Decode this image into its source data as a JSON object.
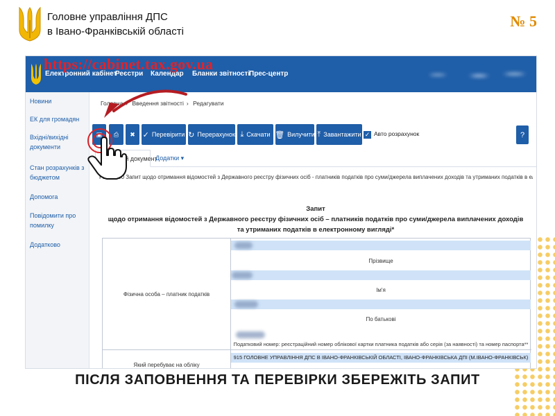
{
  "header": {
    "org_line1": "Головне управління ДПС",
    "org_line2": "в Івано-Франківській області",
    "slide_number": "№ 5"
  },
  "cabinet": {
    "url": "https://cabinet.tax.gov.ua",
    "nav": [
      "Електронний кабінет",
      "Реєстри",
      "Календар",
      "Бланки звітності",
      "Прес-центр"
    ],
    "sidebar": [
      "Новини",
      "ЕК для громадян",
      "Вхідні/вихідні документи",
      "Стан розрахунків з бюджетом",
      "Допомога",
      "Повідомити про помилку",
      "Додатково"
    ],
    "breadcrumbs": [
      "Головна",
      "Введення звітності",
      "Редагувати"
    ],
    "toolbar": {
      "verify": "Перевірити",
      "recalc": "Перерахунок",
      "download": "Скачати",
      "delete": "Вилучити",
      "upload": "Завантажити",
      "auto_calc": "Авто розрахунок",
      "help": "?"
    },
    "tabs": {
      "main": "Головний документ",
      "extra": "Додатки ▾"
    },
    "description": "F1300000 Запит щодо отримання відомостей з Державного реєстру фізичних осіб - платників податків про суми/джерела виплачених доходів та утриманих податків в електронному вигляді",
    "document": {
      "title": "Запит",
      "subtitle": "щодо отримання відомостей з Державного реєстру фізичних осіб – платників податків про суми/джерела виплачених доходів та утриманих податків в електронному вигляді*",
      "person_label": "Фізична особа – платник податків",
      "surname": "Прізвище",
      "name": "Ім'я",
      "patronymic": "По батькові",
      "tax_number_note": "Податковий номер: реєстраційний номер облікової картки платника податків або серія (за наявності) та номер паспорта**",
      "registered_label": "Який перебуває на обліку",
      "tax_office": "915 ГОЛОВНЕ УПРАВЛІННЯ ДПС В ІВАНО-ФРАНКІВСЬКІЙ ОБЛАСТІ, ІВАНО-ФРАНКІВСЬКА ДПІ (М.ІВАНО-ФРАНКІВСЬК)"
    }
  },
  "caption": "ПІСЛЯ ЗАПОВНЕННЯ ТА ПЕРЕВІРКИ ЗБЕРЕЖІТЬ ЗАПИТ",
  "colors": {
    "primary": "#1f5ea8",
    "accent": "#e08a00",
    "annotation": "#d8232a",
    "field_highlight": "#cfe2f7"
  },
  "icons": [
    "trident-logo",
    "save-icon",
    "print-icon",
    "close-icon",
    "check-icon",
    "refresh-icon",
    "download-icon",
    "trash-icon",
    "upload-icon",
    "arrow-annotation",
    "pointer-hand-icon"
  ]
}
